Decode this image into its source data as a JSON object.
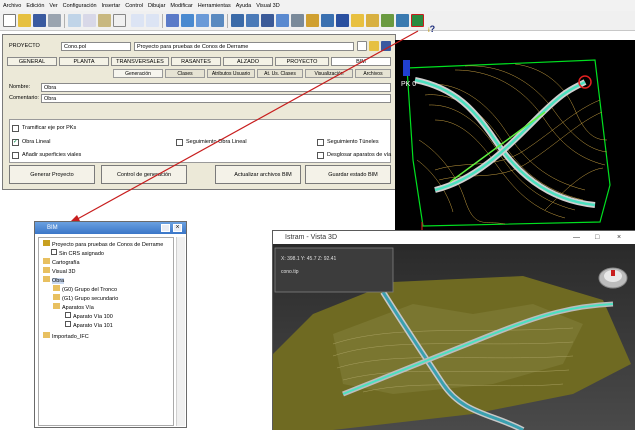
{
  "menu": [
    "Archivo",
    "Edición",
    "Ver",
    "Configuración",
    "Insertar",
    "Control",
    "Dibujar",
    "Modificar",
    "Herramientas",
    "Ayuda",
    "Visual 3D"
  ],
  "toolbar": {
    "help_glyph": "?",
    "icons": [
      "new-icon",
      "open-icon",
      "save-icon",
      "print-icon",
      "cut-icon",
      "copy-icon",
      "paste-icon",
      "delete-icon",
      "undo-icon",
      "redo-icon",
      "select-icon",
      "zoom-icon",
      "pan-icon",
      "layers-icon",
      "view-plan-icon",
      "view-profile-icon",
      "view-section-icon",
      "render-icon",
      "settings-icon",
      "palette-icon",
      "fill-icon",
      "arrow-icon",
      "pencil-icon",
      "folder-icon",
      "measure-icon",
      "road-icon",
      "bim-icon"
    ]
  },
  "dialog": {
    "project_label": "PROYECTO",
    "project_file": "Cono.pol",
    "project_desc": "Proyecto para pruebas de Conos de Derrame",
    "tabs": [
      "GENERAL",
      "PLANTA",
      "TRANSVERSALES",
      "RASANTES",
      "ALZADO",
      "PROYECTO",
      "BIM"
    ],
    "subtabs": [
      "Generación",
      "Clases",
      "Atributos Usuario",
      "At. Us. Clases",
      "Visualización",
      "Archivos"
    ],
    "name_label": "Nombre:",
    "name_value": "Obra",
    "comment_label": "Comentario:",
    "comment_value": "Obra",
    "opt_trace": "Tramificar eje por PKs",
    "opt_linear": "Obra Lineal",
    "opt_follow": "Seguimiento Obra Lineal",
    "opt_tunnels": "Seguimiento Túneles",
    "opt_surfaces": "Añadir superficies viales",
    "opt_devices": "Desglosar aparatos de vía",
    "btn_generate": "Generar Proyecto",
    "btn_control": "Control de generación",
    "btn_update": "Actualizar archivos BIM",
    "btn_save": "Guardar estado BIM"
  },
  "plan_label": "PK 0",
  "bim": {
    "title": "BIM",
    "tree": [
      "Proyecto para pruebas de Conos de Derrame",
      "Sin CRS asignado",
      "Cartografía",
      "Visual 3D",
      "Obra",
      "(G0) Grupo del Tronco",
      "(G1) Grupo secundario",
      "Aparatos Vía",
      "Aparato Vía 100",
      "Aparato Vía 101",
      "Importado_IFC"
    ]
  },
  "view3d": {
    "title": "Istram - Vista 3D",
    "coords": "X: 398.1   Y: 45.7   Z: 92.41",
    "file": "cono.tip",
    "controls": [
      "—",
      "□",
      "×"
    ]
  },
  "colors": {
    "accent": "#c81e1e",
    "titlebar": "#3a76c8",
    "terrain": "#6f6a22",
    "road": "#4ce0c0"
  }
}
